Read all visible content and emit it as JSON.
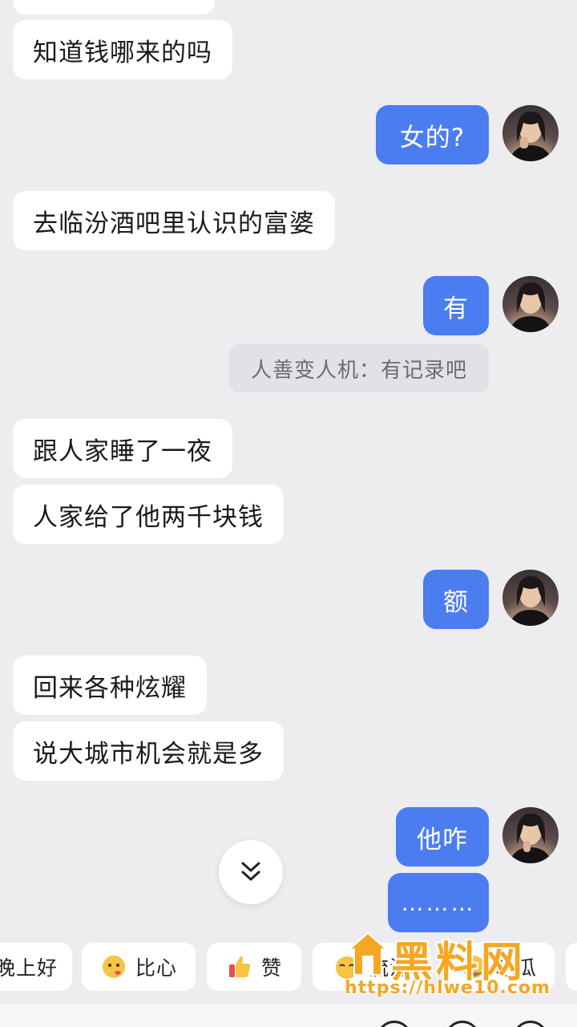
{
  "messages": [
    {
      "from": "them",
      "text": "知道钱哪来的吗"
    },
    {
      "from": "me",
      "text": "女的?"
    },
    {
      "from": "them",
      "text": "去临汾酒吧里认识的富婆"
    },
    {
      "from": "me",
      "text": "有"
    },
    {
      "from": "system",
      "text": "人善变人机：有记录吧"
    },
    {
      "from": "them",
      "text": "跟人家睡了一夜"
    },
    {
      "from": "them",
      "text": "人家给了他两千块钱"
    },
    {
      "from": "me",
      "text": "额"
    },
    {
      "from": "them",
      "text": "回来各种炫耀"
    },
    {
      "from": "them",
      "text": "说大城市机会就是多"
    },
    {
      "from": "me",
      "text": "他咋"
    },
    {
      "from": "me",
      "text": "………"
    }
  ],
  "quick_replies": [
    {
      "label": "晚上好",
      "icon": ""
    },
    {
      "label": "比心",
      "icon": "finger-heart-emoji"
    },
    {
      "label": "赞",
      "icon": "thumbs-up-emoji"
    },
    {
      "label": "流汗",
      "icon": "sweat-emoji"
    },
    {
      "label": "吃瓜",
      "icon": "melon-emoji"
    }
  ],
  "watermark": {
    "title": "黑料网",
    "url": "https://hlwe10.com"
  },
  "colors": {
    "background": "#ededf0",
    "bubble_in": "#ffffff",
    "bubble_out": "#4c7df0",
    "watermark": "#f5a623"
  }
}
